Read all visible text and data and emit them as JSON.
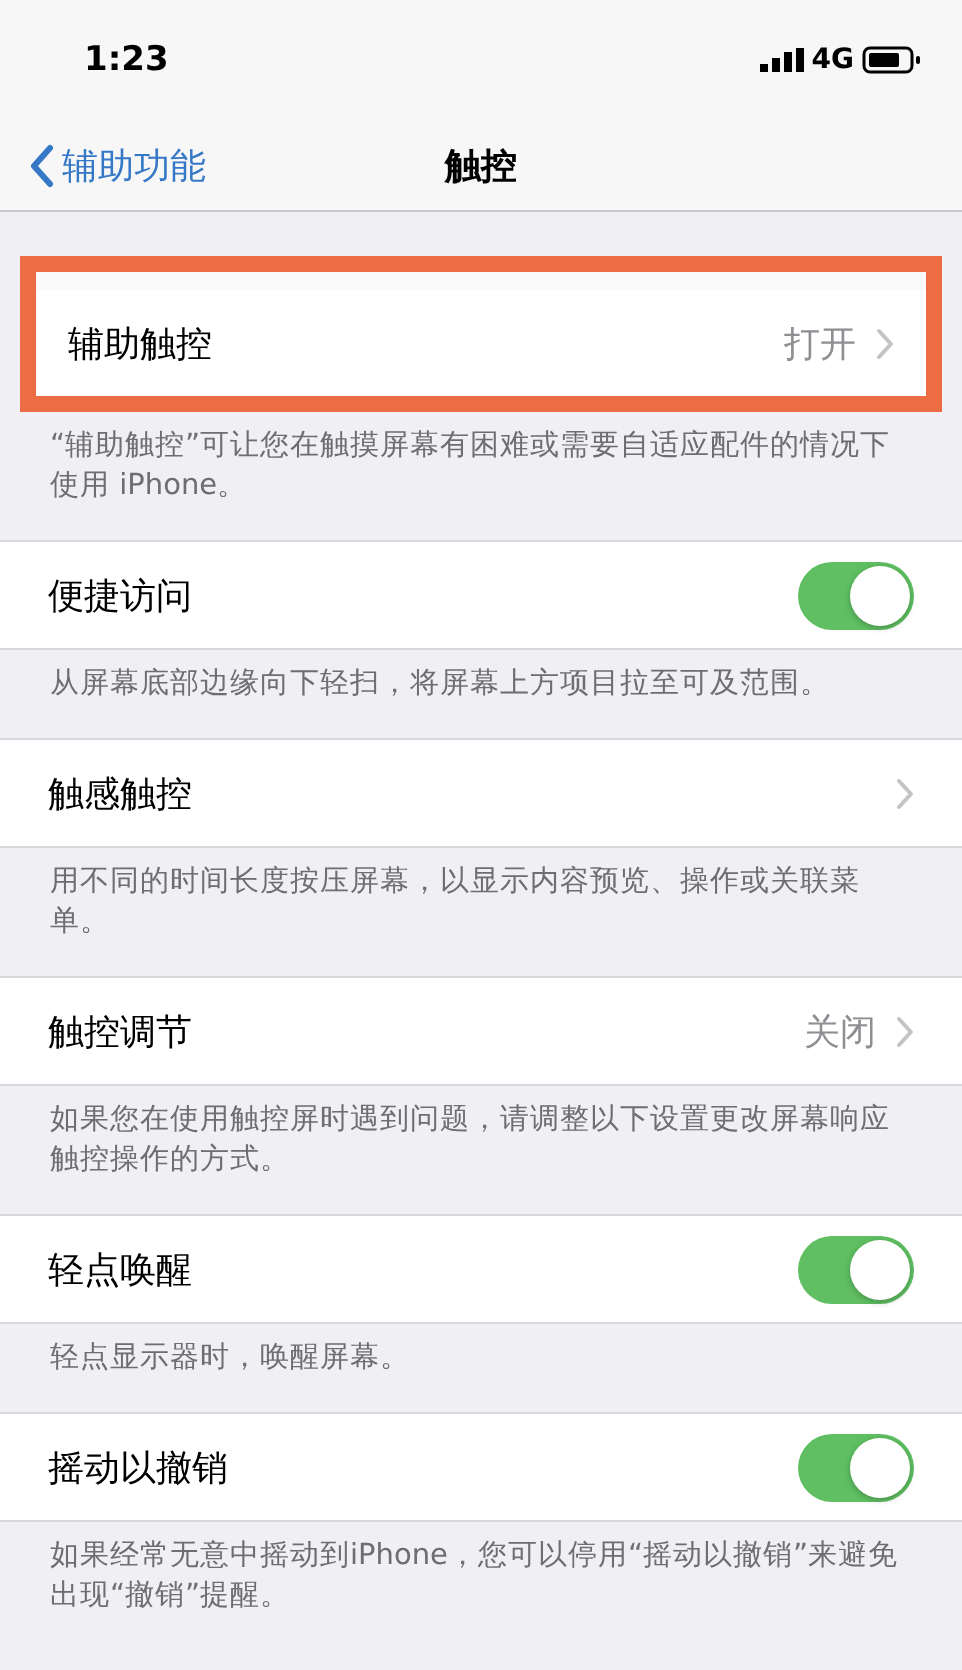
{
  "status_bar": {
    "time": "1:23",
    "network": "4G"
  },
  "nav": {
    "back": "辅助功能",
    "title": "触控"
  },
  "sections": [
    {
      "kind": "link",
      "label": "辅助触控",
      "value": "打开",
      "highlighted": true,
      "footer": "“辅助触控”可让您在触摸屏幕有困难或需要自适应配件的情况下使用 iPhone。"
    },
    {
      "kind": "toggle",
      "label": "便捷访问",
      "on": true,
      "highlighted": false,
      "footer": "从屏幕底部边缘向下轻扫，将屏幕上方项目拉至可及范围。"
    },
    {
      "kind": "link",
      "label": "触感触控",
      "highlighted": false,
      "footer": "用不同的时间长度按压屏幕，以显示内容预览、操作或关联菜单。"
    },
    {
      "kind": "link",
      "label": "触控调节",
      "value": "关闭",
      "highlighted": false,
      "footer": "如果您在使用触控屏时遇到问题，请调整以下设置更改屏幕响应触控操作的方式。"
    },
    {
      "kind": "toggle",
      "label": "轻点唤醒",
      "on": true,
      "highlighted": false,
      "footer": "轻点显示器时，唤醒屏幕。"
    },
    {
      "kind": "toggle",
      "label": "摇动以撤销",
      "on": true,
      "highlighted": false,
      "footer": "如果经常无意中摇动到iPhone，您可以停用“摇动以撤销”来避免出现“撤销”提醒。"
    }
  ]
}
